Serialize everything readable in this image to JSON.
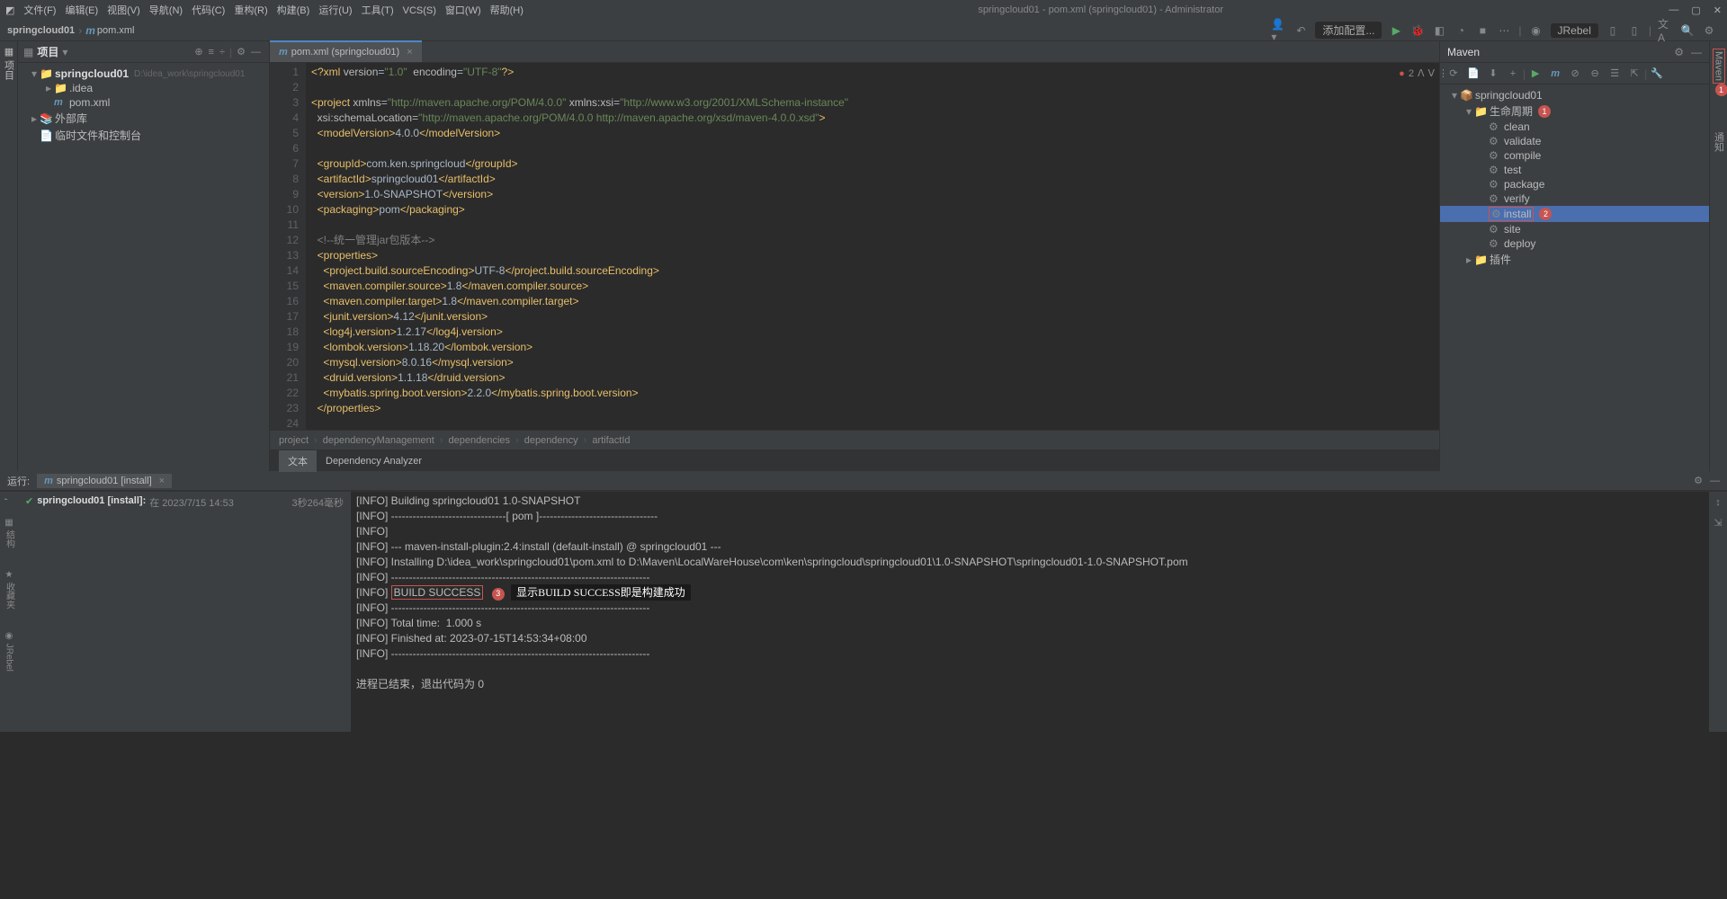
{
  "titlebar": {
    "menus": [
      "文件(F)",
      "编辑(E)",
      "视图(V)",
      "导航(N)",
      "代码(C)",
      "重构(R)",
      "构建(B)",
      "运行(U)",
      "工具(T)",
      "VCS(S)",
      "窗口(W)",
      "帮助(H)"
    ],
    "title": "springcloud01 - pom.xml (springcloud01) - Administrator"
  },
  "navbar": {
    "crumbs": [
      "springcloud01",
      "pom.xml"
    ],
    "run_config": "添加配置...",
    "jrebel": "JRebel"
  },
  "project_panel": {
    "title": "项目",
    "tree": [
      {
        "level": 0,
        "arrow": "▾",
        "icon": "📁",
        "name": "springcloud01",
        "bold": true,
        "path": "D:\\idea_work\\springcloud01"
      },
      {
        "level": 1,
        "arrow": "▸",
        "icon": "📁",
        "name": ".idea"
      },
      {
        "level": 1,
        "arrow": "",
        "icon": "m",
        "name": "pom.xml"
      },
      {
        "level": 0,
        "arrow": "▸",
        "icon": "📚",
        "name": "外部库"
      },
      {
        "level": 0,
        "arrow": "",
        "icon": "📄",
        "name": "临时文件和控制台"
      }
    ]
  },
  "editor_tab": "pom.xml (springcloud01)",
  "editor_status": {
    "errors": "2"
  },
  "breadcrumbs": [
    "project",
    "dependencyManagement",
    "dependencies",
    "dependency",
    "artifactId"
  ],
  "bottom_tabs": [
    "文本",
    "Dependency Analyzer"
  ],
  "maven": {
    "title": "Maven",
    "tree": [
      {
        "level": 0,
        "arrow": "▾",
        "icon": "📦",
        "name": "springcloud01"
      },
      {
        "level": 1,
        "arrow": "▾",
        "icon": "📁",
        "name": "生命周期",
        "badge": "1"
      },
      {
        "level": 2,
        "arrow": "",
        "icon": "⚙",
        "name": "clean"
      },
      {
        "level": 2,
        "arrow": "",
        "icon": "⚙",
        "name": "validate"
      },
      {
        "level": 2,
        "arrow": "",
        "icon": "⚙",
        "name": "compile"
      },
      {
        "level": 2,
        "arrow": "",
        "icon": "⚙",
        "name": "test"
      },
      {
        "level": 2,
        "arrow": "",
        "icon": "⚙",
        "name": "package"
      },
      {
        "level": 2,
        "arrow": "",
        "icon": "⚙",
        "name": "verify"
      },
      {
        "level": 2,
        "arrow": "",
        "icon": "⚙",
        "name": "install",
        "selected": true,
        "badge": "2",
        "boxed": true
      },
      {
        "level": 2,
        "arrow": "",
        "icon": "⚙",
        "name": "site"
      },
      {
        "level": 2,
        "arrow": "",
        "icon": "⚙",
        "name": "deploy"
      },
      {
        "level": 1,
        "arrow": "▸",
        "icon": "📁",
        "name": "插件"
      }
    ]
  },
  "right_gutter_labels": [
    "Maven",
    "通知"
  ],
  "run": {
    "label": "运行:",
    "tab": "springcloud01 [install]",
    "side": {
      "name": "springcloud01 [install]:",
      "info": "在 2023/7/15 14:53",
      "duration": "3秒264毫秒"
    },
    "console_lines": [
      "[INFO] Building springcloud01 1.0-SNAPSHOT",
      "[INFO] --------------------------------[ pom ]---------------------------------",
      "[INFO]",
      "[INFO] --- maven-install-plugin:2.4:install (default-install) @ springcloud01 ---",
      "[INFO] Installing D:\\idea_work\\springcloud01\\pom.xml to D:\\Maven\\LocalWareHouse\\com\\ken\\springcloud\\springcloud01\\1.0-SNAPSHOT\\springcloud01-1.0-SNAPSHOT.pom",
      "[INFO] ------------------------------------------------------------------------",
      "[INFO] BUILD SUCCESS",
      "[INFO] ------------------------------------------------------------------------",
      "[INFO] Total time:  1.000 s",
      "[INFO] Finished at: 2023-07-15T14:53:34+08:00",
      "[INFO] ------------------------------------------------------------------------",
      "",
      "进程已结束，退出代码为 0"
    ],
    "annotation3": "显示BUILD SUCCESS即是构建成功",
    "badge3": "3"
  },
  "code_lines": [
    {
      "n": 1,
      "html": "<span class='t-prolog'>&lt;?xml</span> <span class='t-attr'>version</span>=<span class='t-str'>\"1.0\"</span>  <span class='t-attr'>encoding</span>=<span class='t-str'>\"UTF-8\"</span><span class='t-prolog'>?&gt;</span>"
    },
    {
      "n": 2,
      "html": ""
    },
    {
      "n": 3,
      "html": "<span class='t-tag'>&lt;project</span> <span class='t-attr'>xmlns</span>=<span class='t-str'>\"http://maven.apache.org/POM/4.0.0\"</span> <span class='t-attr'>xmlns:</span><span class='t-attr'>xsi</span>=<span class='t-str'>\"http://www.w3.org/2001/XMLSchema-instance\"</span>"
    },
    {
      "n": 4,
      "html": "  <span class='t-attr'>xsi</span>:<span class='t-attr'>schemaLocation</span>=<span class='t-str'>\"http://maven.apache.org/POM/4.0.0 http://maven.apache.org/xsd/maven-4.0.0.xsd\"</span><span class='t-tag'>&gt;</span>"
    },
    {
      "n": 5,
      "html": "  <span class='t-tag'>&lt;modelVersion&gt;</span>4.0.0<span class='t-tag'>&lt;/modelVersion&gt;</span>"
    },
    {
      "n": 6,
      "html": ""
    },
    {
      "n": 7,
      "html": "  <span class='t-tag'>&lt;groupId&gt;</span>com.ken.springcloud<span class='t-tag'>&lt;/groupId&gt;</span>"
    },
    {
      "n": 8,
      "html": "  <span class='t-tag'>&lt;artifactId&gt;</span>springcloud01<span class='t-tag'>&lt;/artifactId&gt;</span>"
    },
    {
      "n": 9,
      "html": "  <span class='t-tag'>&lt;version&gt;</span>1.0-SNAPSHOT<span class='t-tag'>&lt;/version&gt;</span>"
    },
    {
      "n": 10,
      "html": "  <span class='t-tag'>&lt;packaging&gt;</span>pom<span class='t-tag'>&lt;/packaging&gt;</span>"
    },
    {
      "n": 11,
      "html": ""
    },
    {
      "n": 12,
      "html": "  <span class='t-cmt'>&lt;!--统一管理jar包版本--&gt;</span>"
    },
    {
      "n": 13,
      "html": "  <span class='t-tag'>&lt;properties&gt;</span>"
    },
    {
      "n": 14,
      "html": "    <span class='t-tag'>&lt;project.build.sourceEncoding&gt;</span>UTF-8<span class='t-tag'>&lt;/project.build.sourceEncoding&gt;</span>"
    },
    {
      "n": 15,
      "html": "    <span class='t-tag'>&lt;maven.compiler.source&gt;</span>1.8<span class='t-tag'>&lt;/maven.compiler.source&gt;</span>"
    },
    {
      "n": 16,
      "html": "    <span class='t-tag'>&lt;maven.compiler.target&gt;</span>1.8<span class='t-tag'>&lt;/maven.compiler.target&gt;</span>"
    },
    {
      "n": 17,
      "html": "    <span class='t-tag'>&lt;junit.version&gt;</span>4.12<span class='t-tag'>&lt;/junit.version&gt;</span>"
    },
    {
      "n": 18,
      "html": "    <span class='t-tag'>&lt;log4j.version&gt;</span>1.2.17<span class='t-tag'>&lt;/log4j.version&gt;</span>"
    },
    {
      "n": 19,
      "html": "    <span class='t-tag'>&lt;lombok.version&gt;</span>1.18.20<span class='t-tag'>&lt;/lombok.version&gt;</span>"
    },
    {
      "n": 20,
      "html": "    <span class='t-tag'>&lt;mysql.version&gt;</span>8.0.16<span class='t-tag'>&lt;/mysql.version&gt;</span>"
    },
    {
      "n": 21,
      "html": "    <span class='t-tag'>&lt;druid.version&gt;</span>1.1.18<span class='t-tag'>&lt;/druid.version&gt;</span>"
    },
    {
      "n": 22,
      "html": "    <span class='t-tag'>&lt;mybatis.spring.boot.version&gt;</span>2.2.0<span class='t-tag'>&lt;/mybatis.spring.boot.version&gt;</span>"
    },
    {
      "n": 23,
      "html": "  <span class='t-tag'>&lt;/properties&gt;</span>"
    },
    {
      "n": 24,
      "html": ""
    }
  ]
}
